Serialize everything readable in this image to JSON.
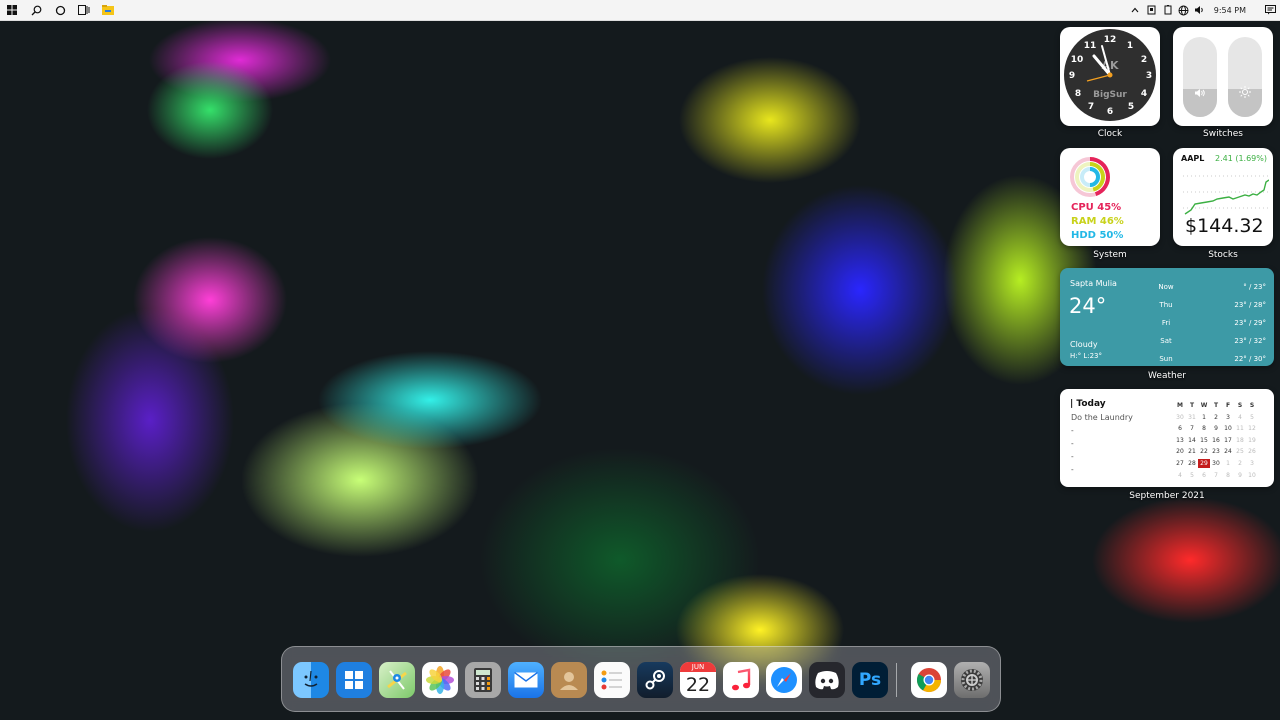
{
  "taskbar": {
    "left_icons": [
      "windows-start-icon",
      "search-icon",
      "cortana-icon",
      "task-view-icon",
      "file-explorer-icon"
    ],
    "tray_icons": [
      "chevron-up-icon",
      "network-device-icon",
      "battery-icon",
      "globe-icon",
      "volume-icon"
    ],
    "time": "9:54 PM"
  },
  "widgets": {
    "clock": {
      "label": "Clock",
      "numbers": [
        "12",
        "1",
        "2",
        "3",
        "4",
        "5",
        "6",
        "7",
        "8",
        "9",
        "10",
        "11"
      ],
      "brand": "AK",
      "subtitle": "BigSur"
    },
    "switches": {
      "label": "Switches",
      "volume_level": 0.35,
      "brightness_level": 0.35
    },
    "system": {
      "label": "System",
      "cpu": "CPU 45%",
      "ram": "RAM 46%",
      "hdd": "HDD 50%",
      "colors": {
        "cpu": "#e5245a",
        "ram": "#c8d21a",
        "hdd": "#22b8e6"
      }
    },
    "stocks": {
      "label": "Stocks",
      "symbol": "AAPL",
      "change": "2.41 (1.69%)",
      "price": "$144.32",
      "change_color": "#3cb043"
    },
    "weather": {
      "label": "Weather",
      "location": "Sapta Mulia",
      "temp": "24°",
      "condition": "Cloudy",
      "hilo": "H:° L:23°",
      "forecast": [
        {
          "day": "Now",
          "range": "° / 23°"
        },
        {
          "day": "Thu",
          "range": "23° / 28°"
        },
        {
          "day": "Fri",
          "range": "23° / 29°"
        },
        {
          "day": "Sat",
          "range": "23° / 32°"
        },
        {
          "day": "Sun",
          "range": "22° / 30°"
        }
      ]
    },
    "calendar": {
      "label": "September 2021",
      "today_heading": "| Today",
      "tasks": [
        "Do the Laundry",
        "-",
        "-",
        "-",
        "-"
      ],
      "weekdays": [
        "M",
        "T",
        "W",
        "T",
        "F",
        "S",
        "S"
      ],
      "weeks": [
        [
          "30",
          "31",
          "1",
          "2",
          "3",
          "4",
          "5"
        ],
        [
          "6",
          "7",
          "8",
          "9",
          "10",
          "11",
          "12"
        ],
        [
          "13",
          "14",
          "15",
          "16",
          "17",
          "18",
          "19"
        ],
        [
          "20",
          "21",
          "22",
          "23",
          "24",
          "25",
          "26"
        ],
        [
          "27",
          "28",
          "29",
          "30",
          "1",
          "2",
          "3"
        ],
        [
          "4",
          "5",
          "6",
          "7",
          "8",
          "9",
          "10"
        ]
      ],
      "today": "29"
    }
  },
  "dock": {
    "apps": [
      {
        "name": "finder",
        "glyph": "☺",
        "color": "#2e8ff0"
      },
      {
        "name": "windows",
        "glyph": "⊞",
        "color": "#1976d2"
      },
      {
        "name": "maps",
        "glyph": "⌖",
        "color": "#5cbf5a"
      },
      {
        "name": "photos",
        "glyph": "✿",
        "color": "#f7f7f7"
      },
      {
        "name": "calculator",
        "glyph": "▦",
        "color": "#9e9e9e"
      },
      {
        "name": "mail",
        "glyph": "✉",
        "color": "#2f8ff5"
      },
      {
        "name": "contacts",
        "glyph": "☻",
        "color": "#b98a52"
      },
      {
        "name": "reminders",
        "glyph": "☰",
        "color": "#f5f5f5"
      },
      {
        "name": "steam",
        "glyph": "♨",
        "color": "#1b2838"
      },
      {
        "name": "calendar",
        "glyph": "22",
        "color": "#ffffff"
      },
      {
        "name": "music",
        "glyph": "♫",
        "color": "#ffffff"
      },
      {
        "name": "safari",
        "glyph": "⊘",
        "color": "#2f8ff5"
      },
      {
        "name": "discord",
        "glyph": "◉",
        "color": "#404eed"
      },
      {
        "name": "photoshop",
        "glyph": "Ps",
        "color": "#001e36"
      },
      {
        "name": "chrome",
        "glyph": "◎",
        "color": "#ffffff"
      },
      {
        "name": "settings",
        "glyph": "⚙",
        "color": "#8e8e8e"
      }
    ],
    "calendar_month": "JUN",
    "calendar_day": "22"
  }
}
